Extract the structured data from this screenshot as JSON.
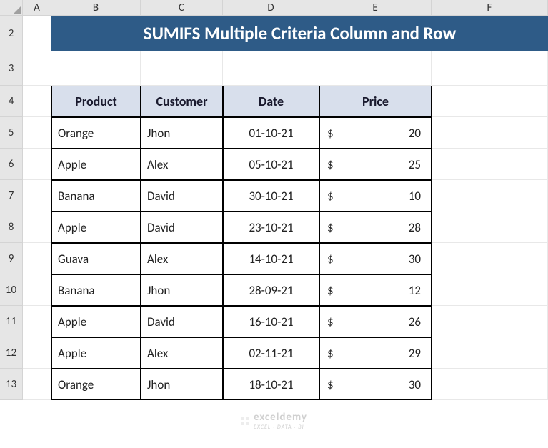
{
  "columns": [
    "A",
    "B",
    "C",
    "D",
    "E",
    "F"
  ],
  "rows": [
    "2",
    "3",
    "4",
    "5",
    "6",
    "7",
    "8",
    "9",
    "10",
    "11",
    "12",
    "13"
  ],
  "title": "SUMIFS Multiple Criteria Column and Row",
  "headers": {
    "product": "Product",
    "customer": "Customer",
    "date": "Date",
    "price": "Price"
  },
  "chart_data": {
    "type": "table",
    "title": "SUMIFS Multiple Criteria Column and Row",
    "columns": [
      "Product",
      "Customer",
      "Date",
      "Price"
    ],
    "rows": [
      {
        "product": "Orange",
        "customer": "Jhon",
        "date": "01-10-21",
        "currency": "$",
        "price": 20
      },
      {
        "product": "Apple",
        "customer": "Alex",
        "date": "05-10-21",
        "currency": "$",
        "price": 25
      },
      {
        "product": "Banana",
        "customer": "David",
        "date": "30-10-21",
        "currency": "$",
        "price": 10
      },
      {
        "product": "Apple",
        "customer": "David",
        "date": "23-10-21",
        "currency": "$",
        "price": 28
      },
      {
        "product": "Guava",
        "customer": "Alex",
        "date": "14-10-21",
        "currency": "$",
        "price": 30
      },
      {
        "product": "Banana",
        "customer": "Jhon",
        "date": "28-09-21",
        "currency": "$",
        "price": 12
      },
      {
        "product": "Apple",
        "customer": "David",
        "date": "16-10-21",
        "currency": "$",
        "price": 26
      },
      {
        "product": "Apple",
        "customer": "Alex",
        "date": "02-11-21",
        "currency": "$",
        "price": 29
      },
      {
        "product": "Orange",
        "customer": "Jhon",
        "date": "18-10-21",
        "currency": "$",
        "price": 30
      }
    ]
  },
  "watermark": {
    "main": "exceldemy",
    "sub": "EXCEL · DATA · BI"
  }
}
